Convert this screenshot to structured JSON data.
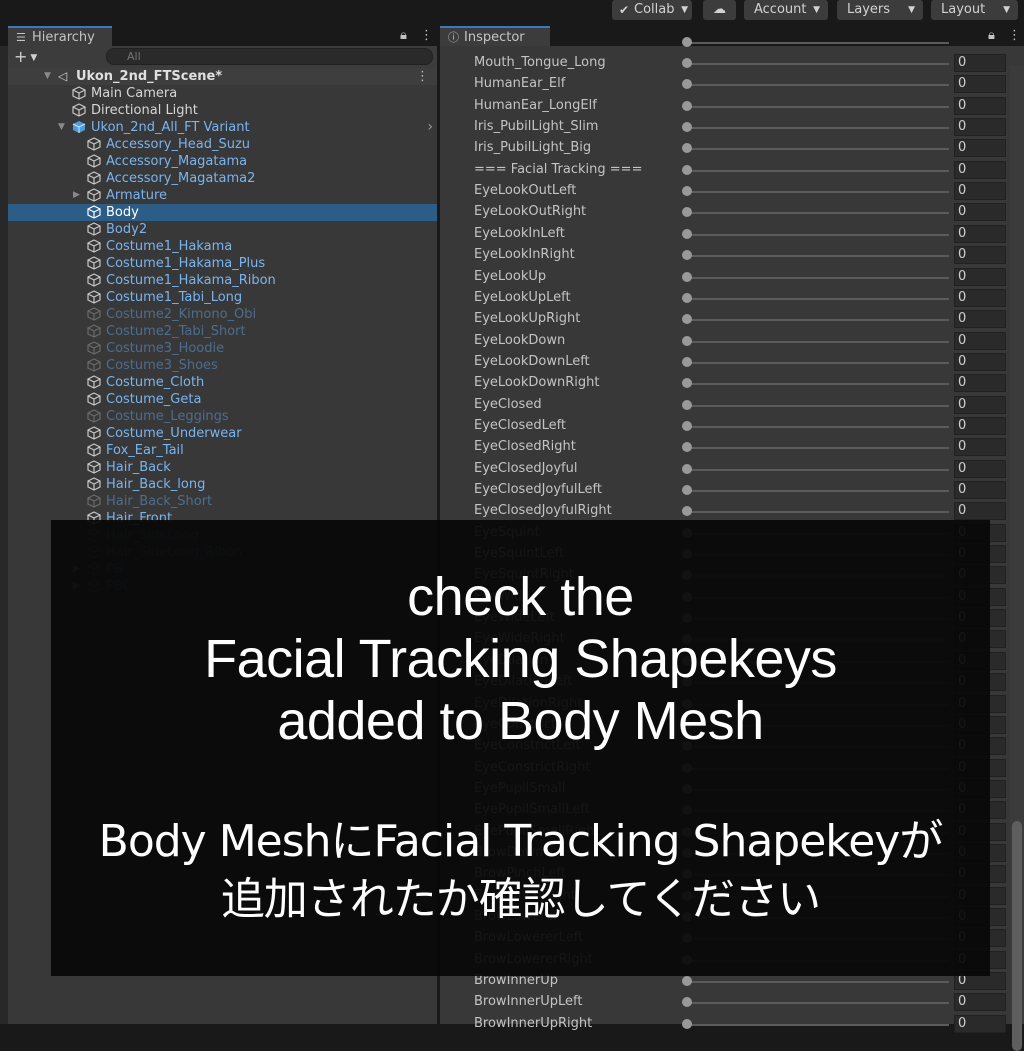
{
  "toolbar": {
    "collab": "Collab",
    "account": "Account",
    "layers": "Layers",
    "layout": "Layout"
  },
  "hierarchy": {
    "tab_label": "Hierarchy",
    "search_placeholder": "All",
    "scene_name": "Ukon_2nd_FTScene*",
    "items": [
      {
        "label": "Main Camera",
        "style": "white",
        "depth": 1,
        "fold": ""
      },
      {
        "label": "Directional Light",
        "style": "white",
        "depth": 1,
        "fold": ""
      },
      {
        "label": "Ukon_2nd_All_FT Variant",
        "style": "blue",
        "depth": 1,
        "fold": "down",
        "prefab_root": true
      },
      {
        "label": "Accessory_Head_Suzu",
        "style": "blue",
        "depth": 2,
        "fold": ""
      },
      {
        "label": "Accessory_Magatama",
        "style": "blue",
        "depth": 2,
        "fold": ""
      },
      {
        "label": "Accessory_Magatama2",
        "style": "blue",
        "depth": 2,
        "fold": ""
      },
      {
        "label": "Armature",
        "style": "blue",
        "depth": 2,
        "fold": "right"
      },
      {
        "label": "Body",
        "style": "sel",
        "depth": 2,
        "fold": "",
        "selected": true
      },
      {
        "label": "Body2",
        "style": "blue",
        "depth": 2,
        "fold": ""
      },
      {
        "label": "Costume1_Hakama",
        "style": "blue",
        "depth": 2,
        "fold": ""
      },
      {
        "label": "Costume1_Hakama_Plus",
        "style": "blue",
        "depth": 2,
        "fold": ""
      },
      {
        "label": "Costume1_Hakama_Ribon",
        "style": "blue",
        "depth": 2,
        "fold": ""
      },
      {
        "label": "Costume1_Tabi_Long",
        "style": "blue",
        "depth": 2,
        "fold": ""
      },
      {
        "label": "Costume2_Kimono_Obi",
        "style": "dim",
        "depth": 2,
        "fold": ""
      },
      {
        "label": "Costume2_Tabi_Short",
        "style": "dim",
        "depth": 2,
        "fold": ""
      },
      {
        "label": "Costume3_Hoodie",
        "style": "dim",
        "depth": 2,
        "fold": ""
      },
      {
        "label": "Costume3_Shoes",
        "style": "dim",
        "depth": 2,
        "fold": ""
      },
      {
        "label": "Costume_Cloth",
        "style": "blue",
        "depth": 2,
        "fold": ""
      },
      {
        "label": "Costume_Geta",
        "style": "blue",
        "depth": 2,
        "fold": ""
      },
      {
        "label": "Costume_Leggings",
        "style": "dim",
        "depth": 2,
        "fold": ""
      },
      {
        "label": "Costume_Underwear",
        "style": "blue",
        "depth": 2,
        "fold": ""
      },
      {
        "label": "Fox_Ear_Tail",
        "style": "blue",
        "depth": 2,
        "fold": ""
      },
      {
        "label": "Hair_Back",
        "style": "blue",
        "depth": 2,
        "fold": ""
      },
      {
        "label": "Hair_Back_long",
        "style": "blue",
        "depth": 2,
        "fold": ""
      },
      {
        "label": "Hair_Back_Short",
        "style": "dim",
        "depth": 2,
        "fold": ""
      },
      {
        "label": "Hair_Front",
        "style": "blue",
        "depth": 2,
        "fold": ""
      },
      {
        "label": "Hair_SideLong",
        "style": "dim",
        "depth": 2,
        "fold": ""
      },
      {
        "label": "Hair_SideLong_Ribon",
        "style": "dim",
        "depth": 2,
        "fold": ""
      },
      {
        "label": "PB",
        "style": "dim",
        "depth": 2,
        "fold": "right"
      },
      {
        "label": "PBC",
        "style": "dim",
        "depth": 2,
        "fold": "right"
      }
    ]
  },
  "inspector": {
    "tab_label": "Inspector",
    "blendshapes": [
      {
        "name": "Mouth_Tongue_Long",
        "value": "0"
      },
      {
        "name": "HumanEar_Elf",
        "value": "0"
      },
      {
        "name": "HumanEar_LongElf",
        "value": "0"
      },
      {
        "name": "Iris_PubilLight_Slim",
        "value": "0"
      },
      {
        "name": "Iris_PubilLight_Big",
        "value": "0"
      },
      {
        "name": "=== Facial Tracking ===",
        "value": "0"
      },
      {
        "name": "EyeLookOutLeft",
        "value": "0"
      },
      {
        "name": "EyeLookOutRight",
        "value": "0"
      },
      {
        "name": "EyeLookInLeft",
        "value": "0"
      },
      {
        "name": "EyeLookInRight",
        "value": "0"
      },
      {
        "name": "EyeLookUp",
        "value": "0"
      },
      {
        "name": "EyeLookUpLeft",
        "value": "0"
      },
      {
        "name": "EyeLookUpRight",
        "value": "0"
      },
      {
        "name": "EyeLookDown",
        "value": "0"
      },
      {
        "name": "EyeLookDownLeft",
        "value": "0"
      },
      {
        "name": "EyeLookDownRight",
        "value": "0"
      },
      {
        "name": "EyeClosed",
        "value": "0"
      },
      {
        "name": "EyeClosedLeft",
        "value": "0"
      },
      {
        "name": "EyeClosedRight",
        "value": "0"
      },
      {
        "name": "EyeClosedJoyful",
        "value": "0"
      },
      {
        "name": "EyeClosedJoyfulLeft",
        "value": "0"
      },
      {
        "name": "EyeClosedJoyfulRight",
        "value": "0"
      },
      {
        "name": "EyeSquint",
        "value": "0"
      },
      {
        "name": "EyeSquintLeft",
        "value": "0"
      },
      {
        "name": "EyeSquintRight",
        "value": "0"
      },
      {
        "name": "EyeWide",
        "value": "0"
      },
      {
        "name": "EyeWideLeft",
        "value": "0"
      },
      {
        "name": "EyeWideRight",
        "value": "0"
      },
      {
        "name": "EyeDilation",
        "value": "0"
      },
      {
        "name": "EyeDilationLeft",
        "value": "0"
      },
      {
        "name": "EyeDilationRight",
        "value": "0"
      },
      {
        "name": "EyeConstrict",
        "value": "0"
      },
      {
        "name": "EyeConstrictLeft",
        "value": "0"
      },
      {
        "name": "EyeConstrictRight",
        "value": "0"
      },
      {
        "name": "EyePupilSmall",
        "value": "0"
      },
      {
        "name": "EyePupilSmallLeft",
        "value": "0"
      },
      {
        "name": "EyePupilSmallRight",
        "value": "0"
      },
      {
        "name": "BrowDown",
        "value": "0"
      },
      {
        "name": "BrowPinchLeft",
        "value": "0"
      },
      {
        "name": "BrowPinchRight",
        "value": "0"
      },
      {
        "name": "BrowLowerer",
        "value": "0"
      },
      {
        "name": "BrowLowererLeft",
        "value": "0"
      },
      {
        "name": "BrowLowererRight",
        "value": "0"
      },
      {
        "name": "BrowInnerUp",
        "value": "0"
      },
      {
        "name": "BrowInnerUpLeft",
        "value": "0"
      },
      {
        "name": "BrowInnerUpRight",
        "value": "0"
      }
    ]
  },
  "overlay": {
    "english_lines": [
      "check the",
      "Facial Tracking Shapekeys",
      "added to Body Mesh"
    ],
    "japanese_lines": [
      "Body MeshにFacial Tracking Shapekeyが",
      "追加されたか確認してください"
    ]
  },
  "colors": {
    "panel_bg": "#383838",
    "selection": "#2c5d87",
    "prefab_text": "#7ab4f0",
    "inactive_text": "#4d6d8f"
  }
}
